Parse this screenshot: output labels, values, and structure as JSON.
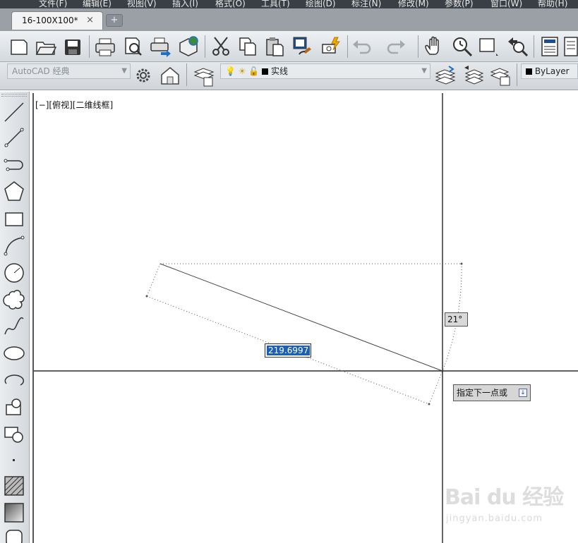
{
  "menubar": {
    "items": [
      "文件(F)",
      "编辑(E)",
      "视图(V)",
      "插入(I)",
      "格式(O)",
      "工具(T)",
      "绘图(D)",
      "标注(N)",
      "修改(M)",
      "参数(P)",
      "窗口(W)",
      "帮助(H)"
    ]
  },
  "tabs": {
    "active_tab": "16-100X100*",
    "close_glyph": "×",
    "new_tab_glyph": "+"
  },
  "toolbar_standard": {
    "icons": [
      "new-file-icon",
      "open-file-icon",
      "save-icon",
      "print-icon",
      "print-preview-icon",
      "publish-icon",
      "3d-publish-icon",
      "cut-icon",
      "copy-icon",
      "paste-icon",
      "match-properties-icon",
      "block-editor-icon",
      "undo-icon",
      "redo-icon",
      "pan-icon",
      "zoom-realtime-icon",
      "zoom-window-icon",
      "zoom-previous-icon",
      "properties-icon",
      "design-center-icon"
    ]
  },
  "toolbar_workspace": {
    "workspace_value": "AutoCAD 经典",
    "layer_value": "实线",
    "color_value": "ByLayer"
  },
  "draw_toolbar": {
    "tools": [
      "line-icon",
      "construction-line-icon",
      "polyline-icon",
      "polygon-icon",
      "rectangle-icon",
      "arc-icon",
      "circle-icon",
      "revision-cloud-icon",
      "spline-icon",
      "ellipse-icon",
      "ellipse-arc-icon",
      "insert-block-icon",
      "make-block-icon",
      "point-icon",
      "hatch-icon",
      "gradient-icon",
      "region-icon"
    ]
  },
  "viewport": {
    "label": "[−][俯视][二维线框]"
  },
  "dynamic_input": {
    "length_value": "219.6997",
    "angle_value": "21°",
    "prompt": "指定下一点或",
    "prompt_arrow": "↓"
  },
  "watermark": {
    "brand": "Bai du 经验",
    "url": "jingyan.baidu.com"
  },
  "colors": {
    "menubar": "#3a3f45",
    "selection": "#1c5fb5",
    "crosshair": "#000000"
  }
}
